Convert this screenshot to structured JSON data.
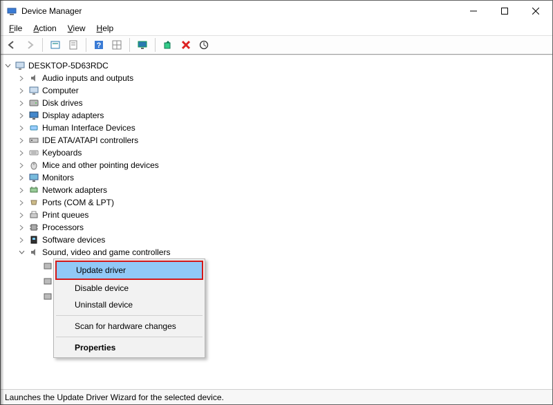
{
  "window": {
    "title": "Device Manager"
  },
  "menubar": {
    "file": "File",
    "action": "Action",
    "view": "View",
    "help": "Help"
  },
  "toolbar_icons": {
    "back": "back-arrow-icon",
    "forward": "forward-arrow-icon",
    "show_hidden": "show-hidden-icon",
    "properties": "properties-icon",
    "help": "help-icon",
    "grid": "grid-icon",
    "monitor": "monitor-icon",
    "update": "update-driver-icon",
    "remove": "remove-icon",
    "scan": "scan-hardware-icon"
  },
  "tree": {
    "root": "DESKTOP-5D63RDC",
    "categories": [
      "Audio inputs and outputs",
      "Computer",
      "Disk drives",
      "Display adapters",
      "Human Interface Devices",
      "IDE ATA/ATAPI controllers",
      "Keyboards",
      "Mice and other pointing devices",
      "Monitors",
      "Network adapters",
      "Ports (COM & LPT)",
      "Print queues",
      "Processors",
      "Software devices",
      "Sound, video and game controllers"
    ]
  },
  "context_menu": {
    "update": "Update driver",
    "disable": "Disable device",
    "uninstall": "Uninstall device",
    "scan": "Scan for hardware changes",
    "properties": "Properties"
  },
  "statusbar": {
    "text": "Launches the Update Driver Wizard for the selected device."
  }
}
